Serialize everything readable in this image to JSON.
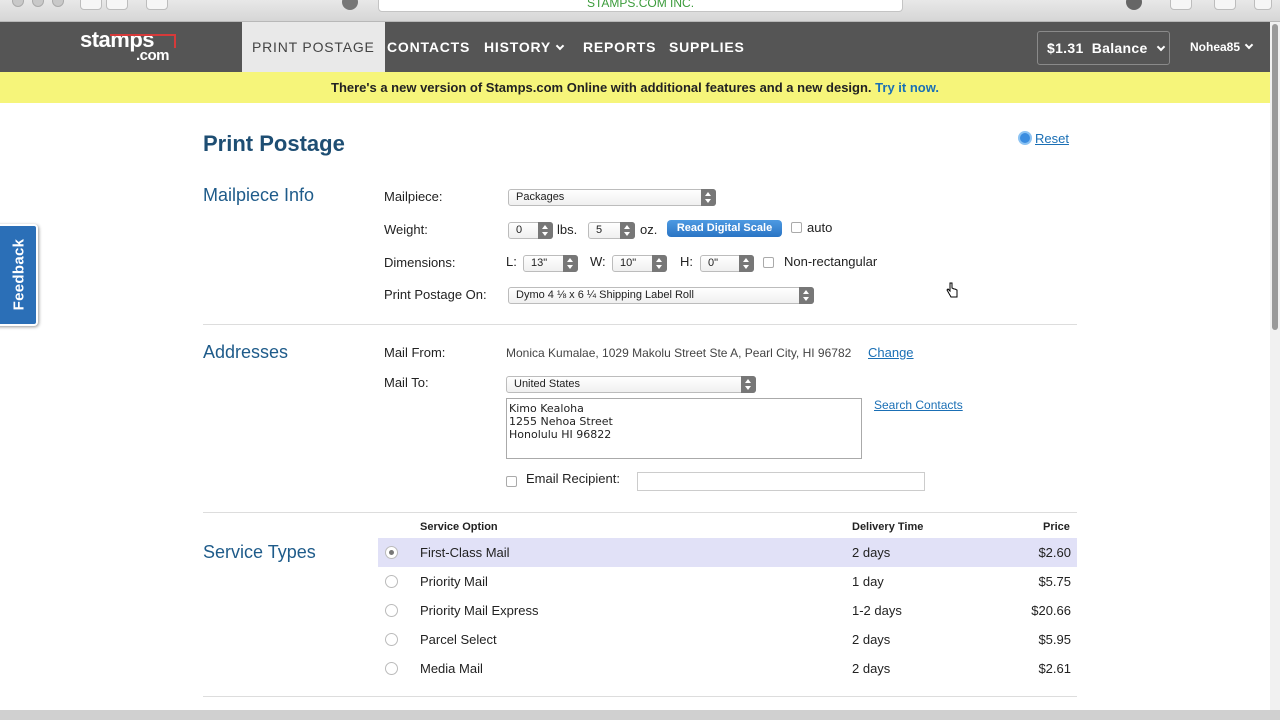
{
  "browser": {
    "url_title": "STAMPS.COM INC."
  },
  "nav": {
    "logo_main": "stamps",
    "logo_suffix": ".com",
    "items": [
      "PRINT POSTAGE",
      "CONTACTS",
      "HISTORY",
      "REPORTS",
      "SUPPLIES"
    ],
    "balance_amount": "$1.31",
    "balance_label": "Balance",
    "username": "Nohea85"
  },
  "banner": {
    "text": "There's a new version of Stamps.com Online with additional features and a new design.",
    "link": "Try it now."
  },
  "feedback_label": "Feedback",
  "page": {
    "title": "Print Postage",
    "reset_label": "Reset"
  },
  "mailpiece_info": {
    "section_title": "Mailpiece Info",
    "mailpiece_label": "Mailpiece:",
    "mailpiece_value": "Packages",
    "weight_label": "Weight:",
    "lbs_value": "0",
    "lbs_unit": "lbs.",
    "oz_value": "5",
    "oz_unit": "oz.",
    "read_scale_button": "Read Digital Scale",
    "auto_label": "auto",
    "dimensions_label": "Dimensions:",
    "l_label": "L:",
    "l_value": "13\"",
    "w_label": "W:",
    "w_value": "10\"",
    "h_label": "H:",
    "h_value": "0\"",
    "nonrect_label": "Non-rectangular",
    "print_on_label": "Print Postage On:",
    "print_on_value": "Dymo 4 ⅛ x 6 ¼ Shipping Label Roll"
  },
  "addresses": {
    "section_title": "Addresses",
    "mail_from_label": "Mail From:",
    "mail_from_value": "Monica Kumalae, 1029 Makolu Street Ste A, Pearl City, HI 96782",
    "change_link": "Change",
    "mail_to_label": "Mail To:",
    "country_value": "United States",
    "address_lines": "Kimo Kealoha\n1255 Nehoa Street\nHonolulu HI 96822",
    "search_contacts_link": "Search Contacts",
    "email_recipient_label": "Email Recipient:",
    "email_value": ""
  },
  "service_types": {
    "section_title": "Service Types",
    "headers": {
      "option": "Service Option",
      "time": "Delivery Time",
      "price": "Price"
    },
    "rows": [
      {
        "name": "First-Class Mail",
        "time": "2 days",
        "price": "$2.60",
        "selected": true
      },
      {
        "name": "Priority Mail",
        "time": "1 day",
        "price": "$5.75",
        "selected": false
      },
      {
        "name": "Priority Mail Express",
        "time": "1-2 days",
        "price": "$20.66",
        "selected": false
      },
      {
        "name": "Parcel Select",
        "time": "2 days",
        "price": "$5.95",
        "selected": false
      },
      {
        "name": "Media Mail",
        "time": "2 days",
        "price": "$2.61",
        "selected": false
      }
    ]
  }
}
